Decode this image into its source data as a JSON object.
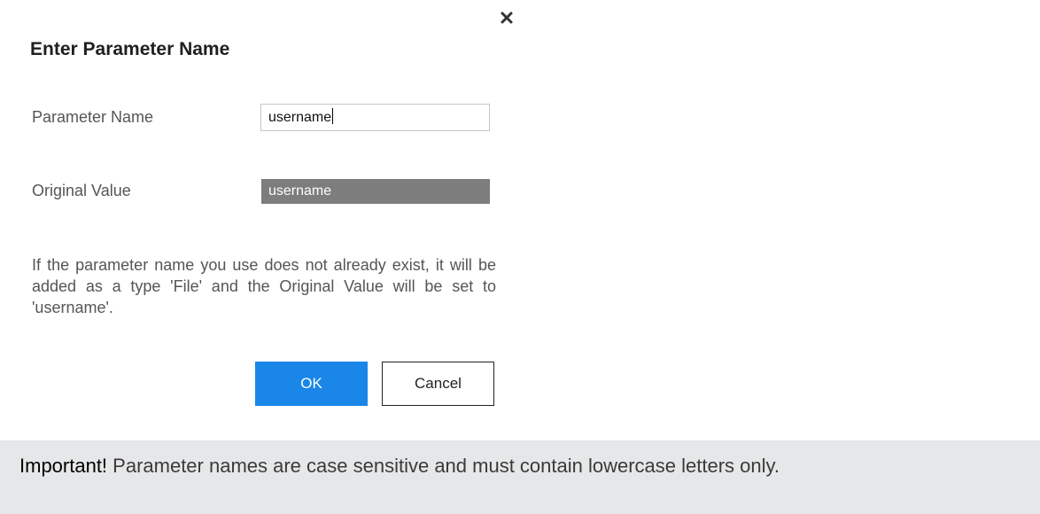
{
  "dialog": {
    "title": "Enter Parameter Name",
    "close_icon": "close-icon",
    "parameter_name_label": "Parameter Name",
    "parameter_name_value": "username",
    "original_value_label": "Original Value",
    "original_value": "username",
    "info_text": "If the parameter name you use does not already exist, it will be added as a type 'File' and the Original Value will be set to 'username'.",
    "ok_label": "OK",
    "cancel_label": "Cancel"
  },
  "note": {
    "strong": "Important!",
    "text": " Parameter names are case sensitive and must contain lowercase letters only."
  },
  "colors": {
    "ok_button": "#1a86e8",
    "original_value_bg": "#7d7d7d",
    "note_bg": "#e6e7e8"
  }
}
